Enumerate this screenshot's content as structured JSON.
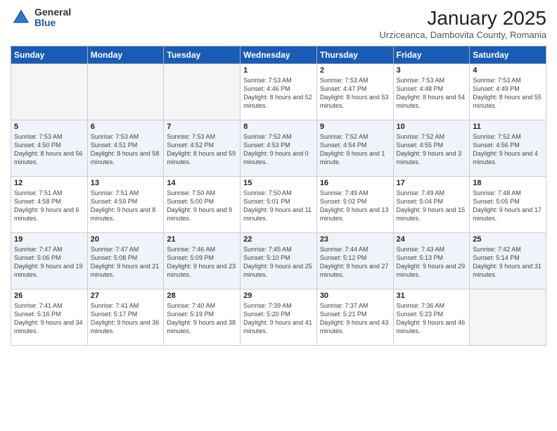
{
  "logo": {
    "general": "General",
    "blue": "Blue"
  },
  "title": "January 2025",
  "subtitle": "Urziceanca, Dambovita County, Romania",
  "headers": [
    "Sunday",
    "Monday",
    "Tuesday",
    "Wednesday",
    "Thursday",
    "Friday",
    "Saturday"
  ],
  "weeks": [
    [
      {
        "day": "",
        "info": ""
      },
      {
        "day": "",
        "info": ""
      },
      {
        "day": "",
        "info": ""
      },
      {
        "day": "1",
        "info": "Sunrise: 7:53 AM\nSunset: 4:46 PM\nDaylight: 8 hours and 52 minutes."
      },
      {
        "day": "2",
        "info": "Sunrise: 7:53 AM\nSunset: 4:47 PM\nDaylight: 8 hours and 53 minutes."
      },
      {
        "day": "3",
        "info": "Sunrise: 7:53 AM\nSunset: 4:48 PM\nDaylight: 8 hours and 54 minutes."
      },
      {
        "day": "4",
        "info": "Sunrise: 7:53 AM\nSunset: 4:49 PM\nDaylight: 8 hours and 55 minutes."
      }
    ],
    [
      {
        "day": "5",
        "info": "Sunrise: 7:53 AM\nSunset: 4:50 PM\nDaylight: 8 hours and 56 minutes."
      },
      {
        "day": "6",
        "info": "Sunrise: 7:53 AM\nSunset: 4:51 PM\nDaylight: 8 hours and 58 minutes."
      },
      {
        "day": "7",
        "info": "Sunrise: 7:53 AM\nSunset: 4:52 PM\nDaylight: 8 hours and 59 minutes."
      },
      {
        "day": "8",
        "info": "Sunrise: 7:52 AM\nSunset: 4:53 PM\nDaylight: 9 hours and 0 minutes."
      },
      {
        "day": "9",
        "info": "Sunrise: 7:52 AM\nSunset: 4:54 PM\nDaylight: 9 hours and 1 minute."
      },
      {
        "day": "10",
        "info": "Sunrise: 7:52 AM\nSunset: 4:55 PM\nDaylight: 9 hours and 3 minutes."
      },
      {
        "day": "11",
        "info": "Sunrise: 7:52 AM\nSunset: 4:56 PM\nDaylight: 9 hours and 4 minutes."
      }
    ],
    [
      {
        "day": "12",
        "info": "Sunrise: 7:51 AM\nSunset: 4:58 PM\nDaylight: 9 hours and 6 minutes."
      },
      {
        "day": "13",
        "info": "Sunrise: 7:51 AM\nSunset: 4:59 PM\nDaylight: 9 hours and 8 minutes."
      },
      {
        "day": "14",
        "info": "Sunrise: 7:50 AM\nSunset: 5:00 PM\nDaylight: 9 hours and 9 minutes."
      },
      {
        "day": "15",
        "info": "Sunrise: 7:50 AM\nSunset: 5:01 PM\nDaylight: 9 hours and 11 minutes."
      },
      {
        "day": "16",
        "info": "Sunrise: 7:49 AM\nSunset: 5:02 PM\nDaylight: 9 hours and 13 minutes."
      },
      {
        "day": "17",
        "info": "Sunrise: 7:49 AM\nSunset: 5:04 PM\nDaylight: 9 hours and 15 minutes."
      },
      {
        "day": "18",
        "info": "Sunrise: 7:48 AM\nSunset: 5:05 PM\nDaylight: 9 hours and 17 minutes."
      }
    ],
    [
      {
        "day": "19",
        "info": "Sunrise: 7:47 AM\nSunset: 5:06 PM\nDaylight: 9 hours and 19 minutes."
      },
      {
        "day": "20",
        "info": "Sunrise: 7:47 AM\nSunset: 5:08 PM\nDaylight: 9 hours and 21 minutes."
      },
      {
        "day": "21",
        "info": "Sunrise: 7:46 AM\nSunset: 5:09 PM\nDaylight: 9 hours and 23 minutes."
      },
      {
        "day": "22",
        "info": "Sunrise: 7:45 AM\nSunset: 5:10 PM\nDaylight: 9 hours and 25 minutes."
      },
      {
        "day": "23",
        "info": "Sunrise: 7:44 AM\nSunset: 5:12 PM\nDaylight: 9 hours and 27 minutes."
      },
      {
        "day": "24",
        "info": "Sunrise: 7:43 AM\nSunset: 5:13 PM\nDaylight: 9 hours and 29 minutes."
      },
      {
        "day": "25",
        "info": "Sunrise: 7:42 AM\nSunset: 5:14 PM\nDaylight: 9 hours and 31 minutes."
      }
    ],
    [
      {
        "day": "26",
        "info": "Sunrise: 7:41 AM\nSunset: 5:16 PM\nDaylight: 9 hours and 34 minutes."
      },
      {
        "day": "27",
        "info": "Sunrise: 7:41 AM\nSunset: 5:17 PM\nDaylight: 9 hours and 36 minutes."
      },
      {
        "day": "28",
        "info": "Sunrise: 7:40 AM\nSunset: 5:19 PM\nDaylight: 9 hours and 38 minutes."
      },
      {
        "day": "29",
        "info": "Sunrise: 7:39 AM\nSunset: 5:20 PM\nDaylight: 9 hours and 41 minutes."
      },
      {
        "day": "30",
        "info": "Sunrise: 7:37 AM\nSunset: 5:21 PM\nDaylight: 9 hours and 43 minutes."
      },
      {
        "day": "31",
        "info": "Sunrise: 7:36 AM\nSunset: 5:23 PM\nDaylight: 9 hours and 46 minutes."
      },
      {
        "day": "",
        "info": ""
      }
    ]
  ]
}
